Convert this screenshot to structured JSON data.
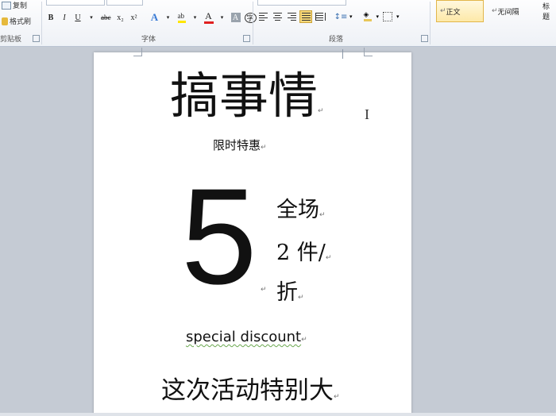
{
  "ribbon": {
    "clipboard": {
      "copy_label": "复制",
      "format_painter_label": "格式刷",
      "group_label": "剪贴板"
    },
    "font": {
      "group_label": "字体",
      "bold": "B",
      "italic": "I",
      "underline": "U",
      "strike": "abc",
      "subscript": "x₂",
      "superscript": "x²",
      "clear_format": "A",
      "font_color": "A",
      "char_border": "A",
      "char_shading": "字"
    },
    "paragraph": {
      "group_label": "段落",
      "active_alignment": "distributed"
    },
    "styles": {
      "items": [
        "正文",
        "无间隔",
        "标题"
      ],
      "active": "正文"
    }
  },
  "document": {
    "title": "搞事情",
    "subtitle": "限时特惠",
    "big_number": "5",
    "offer_line1": "全场",
    "offer_line2": "2 件/",
    "offer_line3": "折",
    "special": "special discount",
    "bottom_line": "这次活动特别大"
  },
  "colors": {
    "highlight": "#f8d879",
    "page": "#ffffff",
    "workspace": "#c5cbd4"
  }
}
